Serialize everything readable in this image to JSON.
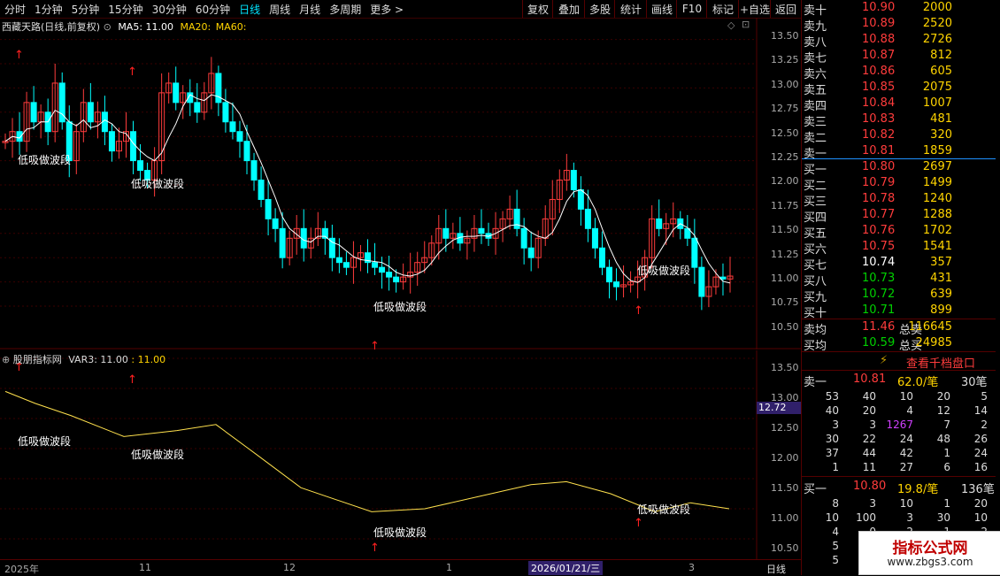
{
  "toolbar": {
    "timeframes": [
      "分时",
      "1分钟",
      "5分钟",
      "15分钟",
      "30分钟",
      "60分钟",
      "日线",
      "周线",
      "月线",
      "多周期",
      "更多 >"
    ],
    "active_timeframe": "日线",
    "right_buttons": [
      "复权",
      "叠加",
      "多股",
      "统计",
      "画线",
      "F10",
      "标记",
      "+自选",
      "返回"
    ]
  },
  "main_chart": {
    "title": "西藏天路(日线,前复权)",
    "ma5_label": "MA5: 11.00",
    "ma20_label": "MA20:",
    "ma60_label": "MA60:",
    "price_axis": [
      "13.50",
      "13.25",
      "13.00",
      "12.75",
      "12.50",
      "12.25",
      "12.00",
      "11.75",
      "11.50",
      "11.25",
      "11.00",
      "10.75",
      "10.50"
    ],
    "signal_label": "低吸做波段"
  },
  "indicator": {
    "title": "股朋指标网",
    "var_label": "VAR3: 11.00",
    "var_value": ": 11.00",
    "axis": [
      "13.50",
      "13.00",
      "12.50",
      "12.00",
      "11.50",
      "11.00",
      "10.50"
    ],
    "cursor_value": "12.72",
    "signal_label": "低吸做波段"
  },
  "date_axis": {
    "labels": [
      "2025年",
      "11",
      "12",
      "1",
      "2026/01/21/三",
      "3"
    ],
    "period": "日线"
  },
  "order_book": {
    "sells": [
      {
        "label": "卖十",
        "price": "10.90",
        "vol": "2000"
      },
      {
        "label": "卖九",
        "price": "10.89",
        "vol": "2520"
      },
      {
        "label": "卖八",
        "price": "10.88",
        "vol": "2726"
      },
      {
        "label": "卖七",
        "price": "10.87",
        "vol": "812"
      },
      {
        "label": "卖六",
        "price": "10.86",
        "vol": "605"
      },
      {
        "label": "卖五",
        "price": "10.85",
        "vol": "2075"
      },
      {
        "label": "卖四",
        "price": "10.84",
        "vol": "1007"
      },
      {
        "label": "卖三",
        "price": "10.83",
        "vol": "481"
      },
      {
        "label": "卖二",
        "price": "10.82",
        "vol": "320"
      },
      {
        "label": "卖一",
        "price": "10.81",
        "vol": "1859"
      }
    ],
    "buys": [
      {
        "label": "买一",
        "price": "10.80",
        "vol": "2697"
      },
      {
        "label": "买二",
        "price": "10.79",
        "vol": "1499"
      },
      {
        "label": "买三",
        "price": "10.78",
        "vol": "1240"
      },
      {
        "label": "买四",
        "price": "10.77",
        "vol": "1288"
      },
      {
        "label": "买五",
        "price": "10.76",
        "vol": "1702"
      },
      {
        "label": "买六",
        "price": "10.75",
        "vol": "1541"
      },
      {
        "label": "买七",
        "price": "10.74",
        "vol": "357"
      },
      {
        "label": "买八",
        "price": "10.73",
        "vol": "431"
      },
      {
        "label": "买九",
        "price": "10.72",
        "vol": "639"
      },
      {
        "label": "买十",
        "price": "10.71",
        "vol": "899"
      }
    ],
    "summary": [
      {
        "label": "卖均",
        "price": "11.46",
        "label2": "总卖",
        "vol": "116645"
      },
      {
        "label": "买均",
        "price": "10.59",
        "label2": "总买",
        "vol": "24985"
      }
    ]
  },
  "detail": {
    "button": "查看千档盘口",
    "sell_header": {
      "label": "卖一",
      "price": "10.81",
      "per": "62.0/笔",
      "count": "30笔"
    },
    "sell_grid": [
      [
        "53",
        "40",
        "10",
        "20",
        "5"
      ],
      [
        "40",
        "20",
        "4",
        "12",
        "14"
      ],
      [
        "3",
        "3",
        "1267",
        "7",
        "2"
      ],
      [
        "30",
        "22",
        "24",
        "48",
        "26"
      ],
      [
        "37",
        "44",
        "42",
        "1",
        "24"
      ],
      [
        "1",
        "11",
        "27",
        "6",
        "16"
      ]
    ],
    "buy_header": {
      "label": "买一",
      "price": "10.80",
      "per": "19.8/笔",
      "count": "136笔"
    },
    "buy_grid": [
      [
        "8",
        "3",
        "10",
        "1",
        "20"
      ],
      [
        "10",
        "100",
        "3",
        "30",
        "10"
      ],
      [
        "4",
        "0",
        "2",
        "1",
        "2"
      ],
      [
        "5",
        "",
        "",
        "",
        ""
      ],
      [
        "5",
        "",
        "",
        "",
        ""
      ]
    ]
  },
  "watermark": {
    "title": "指标公式网",
    "url": "www.zbgs3.com"
  },
  "colors": {
    "up": "#ff3c3c",
    "down": "#00ffff",
    "ma": "#ffffff",
    "var": "#ffe14d",
    "accent": "#00e5ff"
  }
}
